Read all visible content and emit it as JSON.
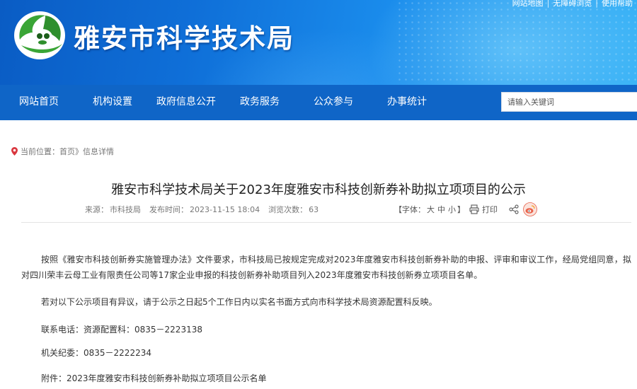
{
  "header": {
    "site_title": "雅安市科学技术局",
    "top_links": [
      "网站地图",
      "无障碍浏览",
      "使用帮助"
    ],
    "colors": {
      "banner_blue": "#0f6fd8",
      "nav_blue": "#0f65c7",
      "logo_green": "#3aa536"
    }
  },
  "nav": {
    "items": [
      "网站首页",
      "机构设置",
      "政府信息公开",
      "政务服务",
      "公众参与",
      "办事统计"
    ],
    "search_placeholder": "请输入关键词"
  },
  "breadcrumb": {
    "label": "当前位置：",
    "home": "首页",
    "separator": "》",
    "current": "信息详情"
  },
  "article": {
    "title": "雅安市科学技术局关于2023年度雅安市科技创新券补助拟立项项目的公示",
    "meta": {
      "source_label": "来源：",
      "source": "市科技局",
      "date_label": "发布时间：",
      "date": "2023-11-15 18:04",
      "views_label": "浏览次数：",
      "views": "63"
    },
    "tools": {
      "font_label": "【字体：",
      "font_large": "大",
      "font_medium": "中",
      "font_small": "小",
      "font_close": "】",
      "print": "打印",
      "icons": [
        "print-icon",
        "share-icon",
        "weibo-icon"
      ]
    },
    "paragraphs": [
      "按照《雅安市科技创新券实施管理办法》文件要求，市科技局已按规定完成对2023年度雅安市科技创新券补助的申报、评审和审议工作，经局党组同意，拟对四川荣丰云母工业有限责任公司等17家企业申报的科技创新券补助项目列入2023年度雅安市科技创新券立项项目名单。",
      "若对以下公示项目有异议，请于公示之日起5个工作日内以实名书面方式向市科学技术局资源配置科反映。",
      "联系电话：资源配置科：0835－2223138",
      "机关纪委：0835－2222234",
      "附件：2023年度雅安市科技创新券补助拟立项项目公示名单"
    ]
  }
}
